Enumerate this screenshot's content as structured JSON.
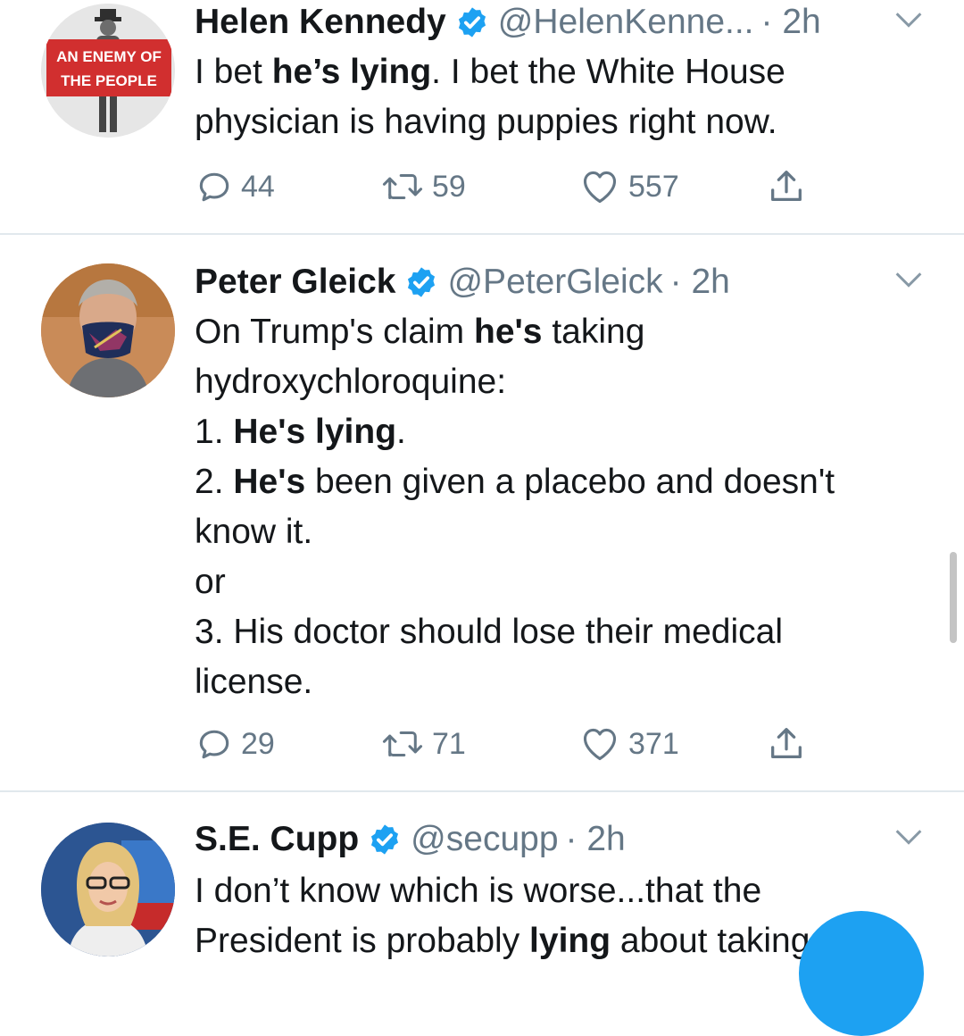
{
  "tweets": [
    {
      "name": "Helen Kennedy",
      "handle": "@HelenKenne...",
      "time": "· 2h",
      "avatar_text": [
        "AN ENEMY OF",
        "THE PEOPLE"
      ],
      "lines": [
        [
          {
            "t": "I bet "
          },
          {
            "t": "he’s lying",
            "b": true
          },
          {
            "t": ". I bet the White House"
          }
        ],
        [
          {
            "t": "physician is having puppies right now."
          }
        ]
      ],
      "replies": "44",
      "retweets": "59",
      "likes": "557"
    },
    {
      "name": "Peter Gleick",
      "handle": "@PeterGleick",
      "time": "· 2h",
      "lines": [
        [
          {
            "t": "On Trump's claim "
          },
          {
            "t": "he's",
            "b": true
          },
          {
            "t": " taking"
          }
        ],
        [
          {
            "t": "hydroxychloroquine:"
          }
        ],
        [
          {
            "t": "1. "
          },
          {
            "t": "He's lying",
            "b": true
          },
          {
            "t": "."
          }
        ],
        [
          {
            "t": "2. "
          },
          {
            "t": "He's",
            "b": true
          },
          {
            "t": " been given a placebo and doesn't"
          }
        ],
        [
          {
            "t": "know it."
          }
        ],
        [
          {
            "t": "or"
          }
        ],
        [
          {
            "t": "3. His doctor should lose their medical"
          }
        ],
        [
          {
            "t": "license."
          }
        ]
      ],
      "replies": "29",
      "retweets": "71",
      "likes": "371"
    },
    {
      "name": "S.E. Cupp",
      "handle": "@secupp",
      "time": "· 2h",
      "lines": [
        [
          {
            "t": "I don’t know which is worse...that the"
          }
        ],
        [
          {
            "t": "President is probably "
          },
          {
            "t": "lying",
            "b": true
          },
          {
            "t": " about taking"
          }
        ]
      ]
    }
  ],
  "colors": {
    "verified": "#1da1f2",
    "muted": "#657786",
    "avatar_red": "#d12f2f"
  },
  "icons": [
    "reply-icon",
    "retweet-icon",
    "like-icon",
    "share-icon",
    "verified-badge-icon",
    "chevron-down-icon"
  ]
}
